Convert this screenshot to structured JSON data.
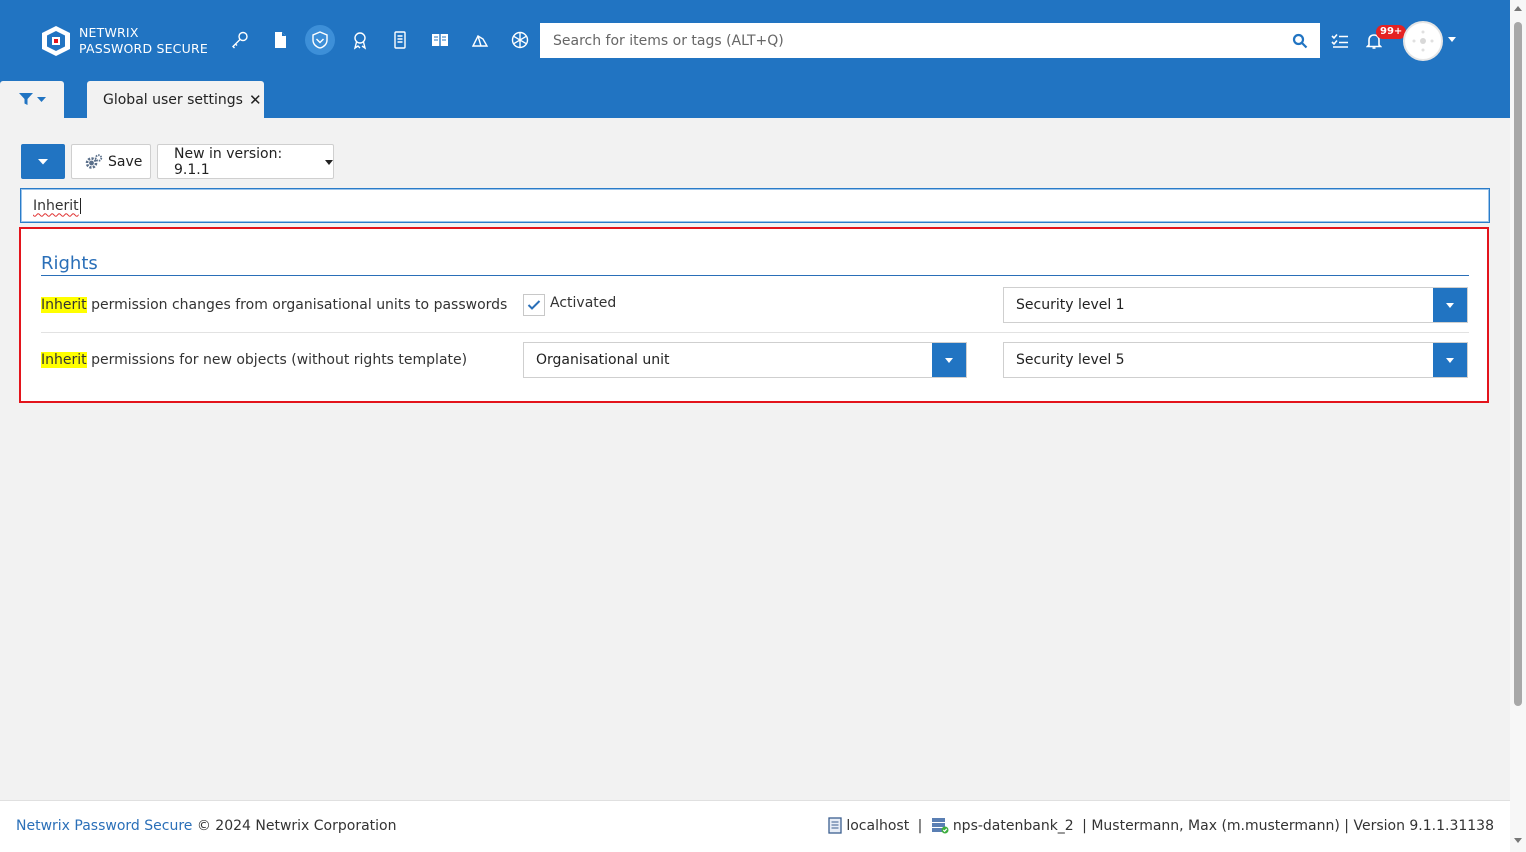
{
  "app": {
    "brand_line1": "NETWRIX",
    "brand_line2": "PASSWORD SECURE",
    "accent_color": "#2174c2"
  },
  "header": {
    "nav_icons": [
      "key-icon",
      "document-icon",
      "shield-icon",
      "certificate-icon",
      "server-icon",
      "book-icon",
      "cloud-icon",
      "snowflake-icon"
    ],
    "active_nav": "shield-icon",
    "search_placeholder": "Search for items or tags (ALT+Q)",
    "notification_badge": "99+"
  },
  "tabs": {
    "active_tab": "Global user settings"
  },
  "toolbar": {
    "save_label": "Save",
    "new_in_version_label": "New in version: 9.1.1"
  },
  "filter": {
    "value": "Inherit"
  },
  "section": {
    "title": "Rights",
    "rows": [
      {
        "highlight": "Inherit",
        "label_rest": " permission changes from organisational units to passwords",
        "checkbox_checked": true,
        "checkbox_label": "Activated",
        "security_level": "Security level 1"
      },
      {
        "highlight": "Inherit",
        "label_rest": " permissions for new objects (without rights template)",
        "option_value": "Organisational unit",
        "security_level": "Security level 5"
      }
    ]
  },
  "footer": {
    "brand": "Netwrix Password Secure",
    "copyright": " © 2024 Netwrix Corporation",
    "server": "localhost",
    "separator1": " | ",
    "database": "nps-datenbank_2",
    "rest": " | Mustermann, Max (m.mustermann) | Version 9.1.1.31138"
  }
}
